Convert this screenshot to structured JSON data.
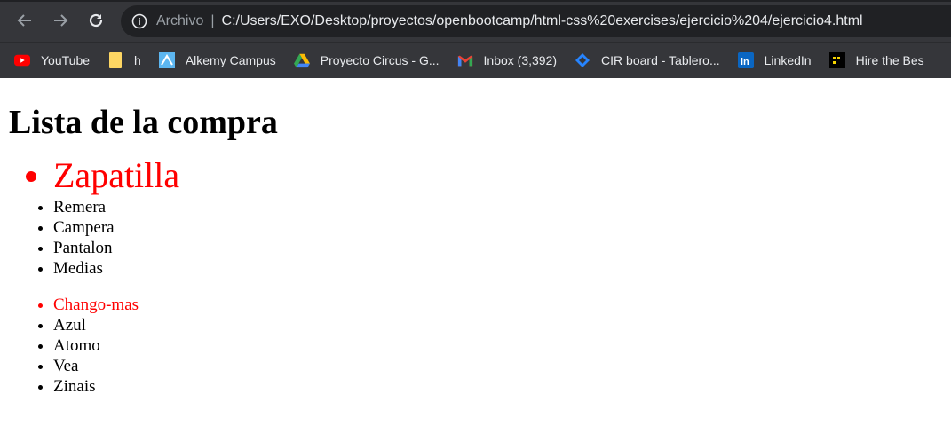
{
  "browser": {
    "address_prefix": "Archivo",
    "address_separator": "|",
    "url": "C:/Users/EXO/Desktop/proyectos/openbootcamp/html-css%20exercises/ejercicio%204/ejercicio4.html",
    "bookmarks": [
      {
        "label": "YouTube",
        "icon": "youtube-icon"
      },
      {
        "label": "h",
        "icon": "folder-icon"
      },
      {
        "label": "Alkemy Campus",
        "icon": "alkemy-icon"
      },
      {
        "label": "Proyecto Circus - G...",
        "icon": "google-drive-icon"
      },
      {
        "label": "Inbox (3,392)",
        "icon": "gmail-icon"
      },
      {
        "label": "CIR board - Tablero...",
        "icon": "jira-icon"
      },
      {
        "label": "LinkedIn",
        "icon": "linkedin-icon"
      },
      {
        "label": "Hire the Bes",
        "icon": "dots-logo-icon"
      }
    ]
  },
  "page": {
    "title": "Lista de la compra",
    "list_a": [
      "Zapatilla",
      "Remera",
      "Campera",
      "Pantalon",
      "Medias"
    ],
    "list_b": [
      "Chango-mas",
      "Azul",
      "Atomo",
      "Vea",
      "Zinais"
    ]
  },
  "colors": {
    "chrome_bg": "#35363a",
    "omnibox_bg": "#202124",
    "highlight": "#ff0000"
  }
}
